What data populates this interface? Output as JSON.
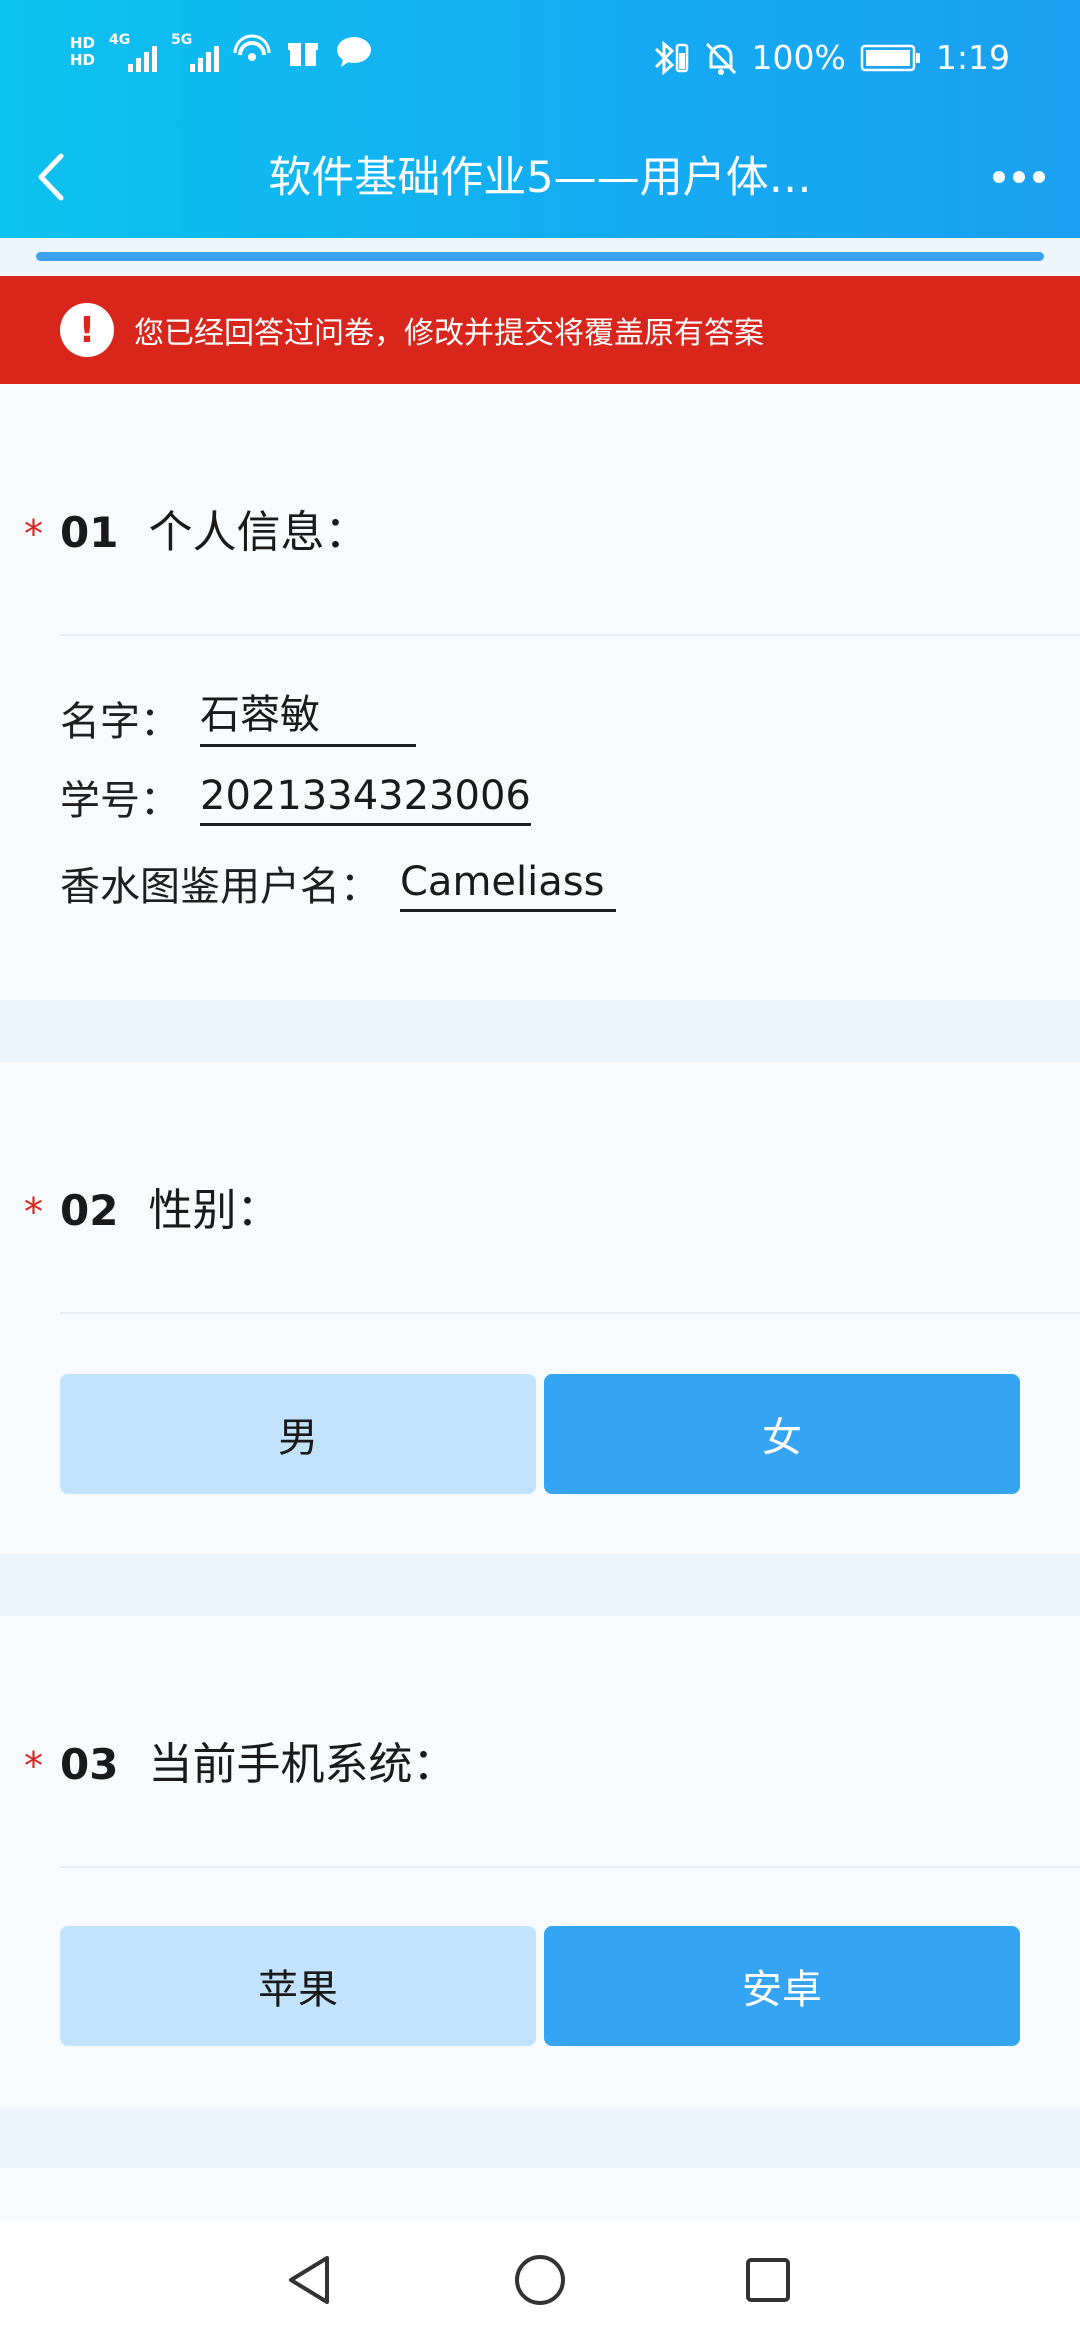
{
  "status_bar": {
    "hd_top": "HD",
    "hd_bottom": "HD",
    "sim1_tag": "4G",
    "sim2_tag": "5G",
    "battery": "100%",
    "time": "1:19",
    "icons": [
      "signal-icon",
      "wifi-icon",
      "gift-icon",
      "chat-icon",
      "bluetooth-icon",
      "mute-icon",
      "battery-icon"
    ]
  },
  "header": {
    "title": "软件基础作业5——用户体…"
  },
  "progress": {
    "value": 1.0,
    "fill_color": "#3aa2ee"
  },
  "alert": {
    "text": "您已经回答过问卷，修改并提交将覆盖原有答案",
    "color": "#d9261d"
  },
  "questions": [
    {
      "required_mark": "*",
      "number": "01",
      "title": "个人信息：",
      "fields": [
        {
          "label": "名字：",
          "value": "石蓉敏"
        },
        {
          "label": "学号：",
          "value": "2021334323006"
        },
        {
          "label": "香水图鉴用户名：",
          "value": "Cameliass"
        }
      ]
    },
    {
      "required_mark": "*",
      "number": "02",
      "title": "性别：",
      "options": [
        {
          "label": "男",
          "selected": false
        },
        {
          "label": "女",
          "selected": true
        }
      ]
    },
    {
      "required_mark": "*",
      "number": "03",
      "title": "当前手机系统：",
      "options": [
        {
          "label": "苹果",
          "selected": false
        },
        {
          "label": "安卓",
          "selected": true
        }
      ]
    }
  ],
  "colors": {
    "header_start": "#0cc2ee",
    "header_end": "#1aa0f0",
    "option_unselected": "#c2e3fb",
    "option_selected": "#35a5f3"
  }
}
